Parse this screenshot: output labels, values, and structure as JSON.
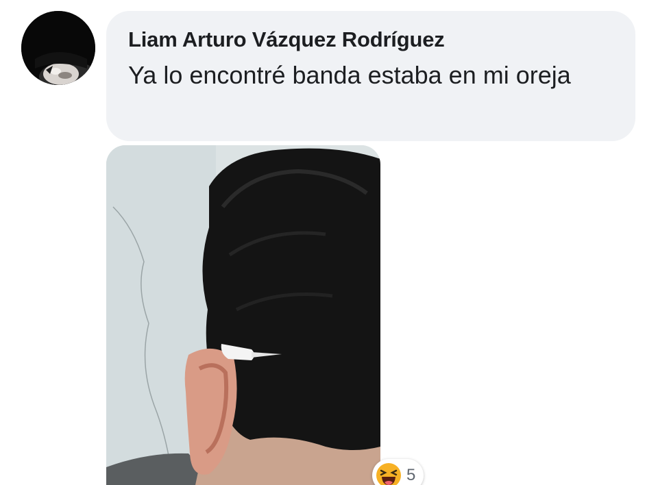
{
  "comment": {
    "author": "Liam Arturo Vázquez Rodríguez",
    "text": "Ya lo encontré banda estaba en mi oreja",
    "avatar_icon": "profile-avatar",
    "photo_icon": "photo-attachment",
    "reaction": {
      "icon": "haha-emoji-icon",
      "count": "5"
    }
  },
  "colors": {
    "bubble": "#f0f2f5",
    "text": "#1c1e21",
    "count": "#606770",
    "emoji": "#f7b125"
  }
}
